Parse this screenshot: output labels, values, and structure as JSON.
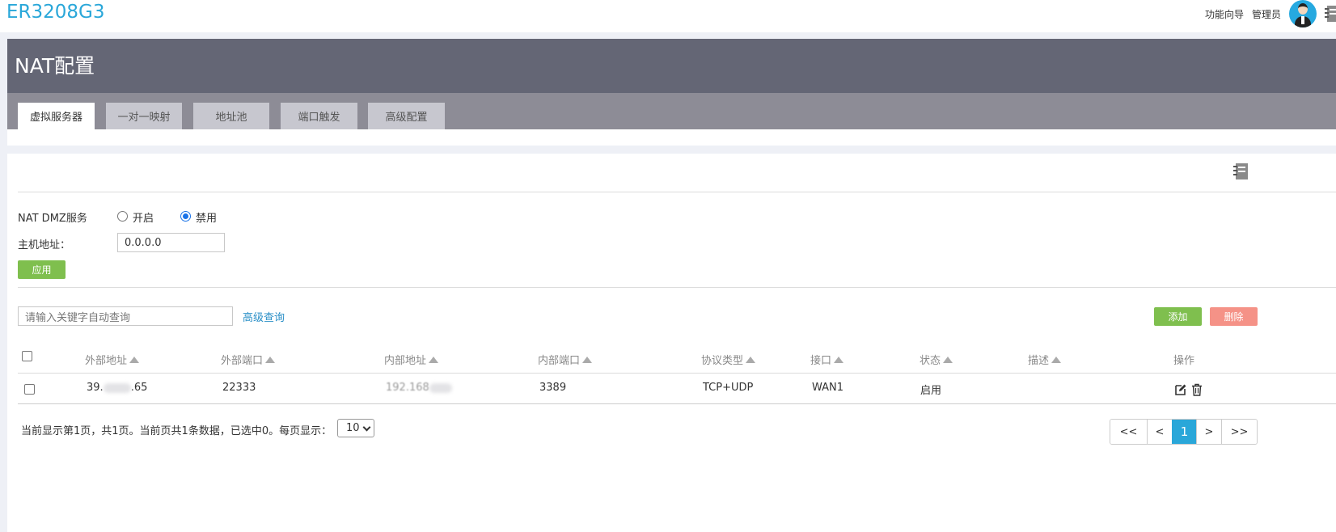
{
  "app": {
    "brand": "ER3208G3",
    "nav_wizard": "功能向导",
    "nav_admin": "管理员"
  },
  "page": {
    "title": "NAT配置"
  },
  "tabs": [
    {
      "label": "虚拟服务器",
      "active": true
    },
    {
      "label": "一对一映射",
      "active": false
    },
    {
      "label": "地址池",
      "active": false
    },
    {
      "label": "端口触发",
      "active": false
    },
    {
      "label": "高级配置",
      "active": false
    }
  ],
  "dmz": {
    "label": "NAT DMZ服务",
    "option_on": "开启",
    "option_off": "禁用",
    "selected": "禁用",
    "host_label": "主机地址：",
    "host_value": "0.0.0.0",
    "apply_label": "应用"
  },
  "search": {
    "placeholder": "请输入关键字自动查询",
    "advanced_label": "高级查询"
  },
  "toolbar": {
    "add_label": "添加",
    "delete_label": "删除"
  },
  "table": {
    "columns": [
      "外部地址",
      "外部端口",
      "内部地址",
      "内部端口",
      "协议类型",
      "接口",
      "状态",
      "描述",
      "操作"
    ],
    "rows": [
      {
        "external_addr_start": "39.",
        "external_addr_end": ".65",
        "external_port": "22333",
        "internal_addr_start": "192.168",
        "internal_port": "3389",
        "protocol": "TCP+UDP",
        "interface": "WAN1",
        "status": "启用",
        "description": ""
      }
    ]
  },
  "footer": {
    "summary": "当前显示第1页，共1页。当前页共1条数据，已选中0。每页显示：",
    "page_size": "10"
  },
  "pagination": {
    "first": "<<",
    "prev": "<",
    "current": "1",
    "next": ">",
    "last": ">>"
  },
  "colors": {
    "brand": "#2aa7d9",
    "header_bg": "#646675",
    "tabs_bg": "#8d8c96",
    "add_button": "#7fbf4e",
    "delete_button": "#f59287",
    "pager_active": "#2aa7d9"
  },
  "icons": {
    "avatar": "admin-avatar-icon",
    "manual": "notebook-icon",
    "edit": "edit-icon",
    "delete": "trash-icon",
    "sort": "sort-asc-icon"
  }
}
